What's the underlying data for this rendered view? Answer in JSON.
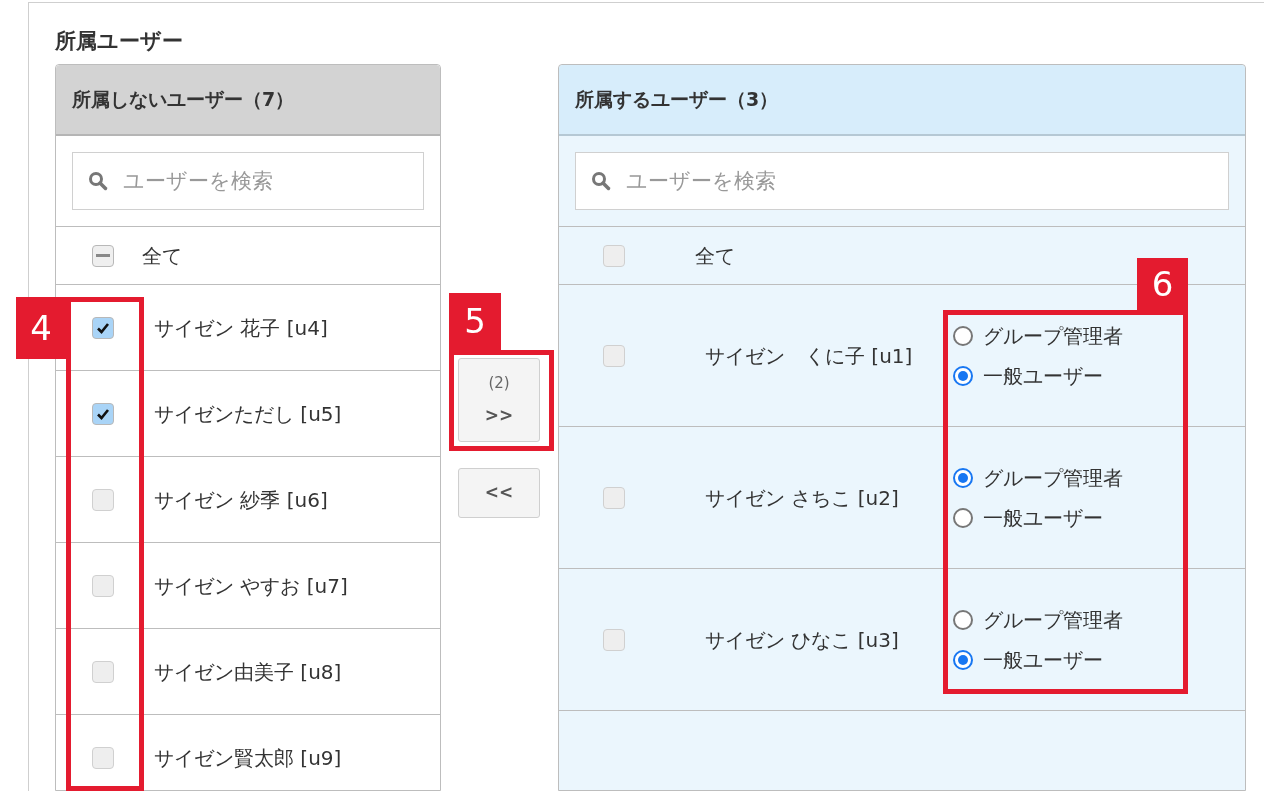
{
  "title": "所属ユーザー",
  "not_members": {
    "header": "所属しないユーザー（7）",
    "search": {
      "placeholder": "ユーザーを検索"
    },
    "all": {
      "label": "全て",
      "indeterminate": true
    },
    "users": [
      {
        "name": "サイゼン 花子 [u4]",
        "checked": true
      },
      {
        "name": "サイゼンただし [u5]",
        "checked": true
      },
      {
        "name": "サイゼン 紗季 [u6]",
        "checked": false
      },
      {
        "name": "サイゼン やすお [u7]",
        "checked": false
      },
      {
        "name": "サイゼン由美子 [u8]",
        "checked": false
      },
      {
        "name": "サイゼン賢太郎 [u9]",
        "checked": false
      }
    ]
  },
  "move_buttons": [
    {
      "count": "(2)",
      "label": ">>"
    },
    {
      "label": "<<"
    }
  ],
  "members": {
    "header": "所属するユーザー（3）",
    "search": {
      "placeholder": "ユーザーを検索"
    },
    "all": {
      "label": "全て",
      "indeterminate": false
    },
    "users": [
      {
        "name": "サイゼン　くに子 [u1]",
        "checked": false,
        "roles": [
          {
            "label": "グループ管理者",
            "selected": false
          },
          {
            "label": "一般ユーザー",
            "selected": true
          }
        ]
      },
      {
        "name": "サイゼン さちこ [u2]",
        "checked": false,
        "roles": [
          {
            "label": "グループ管理者",
            "selected": true
          },
          {
            "label": "一般ユーザー",
            "selected": false
          }
        ]
      },
      {
        "name": "サイゼン ひなこ [u3]",
        "checked": false,
        "roles": [
          {
            "label": "グループ管理者",
            "selected": false
          },
          {
            "label": "一般ユーザー",
            "selected": true
          }
        ]
      }
    ]
  },
  "callouts": [
    {
      "label": "4"
    },
    {
      "label": "5"
    },
    {
      "label": "6"
    }
  ]
}
